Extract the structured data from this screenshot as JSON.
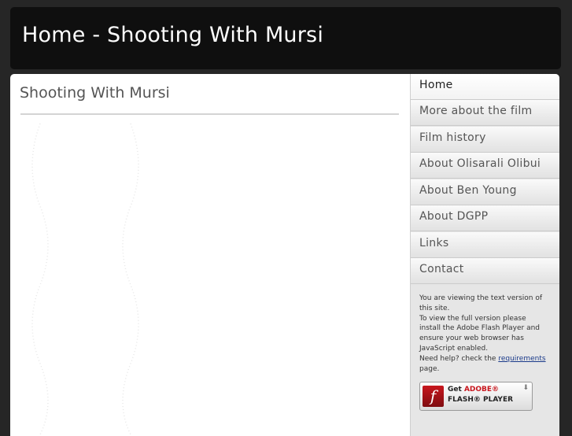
{
  "header": {
    "title": "Home - Shooting With Mursi"
  },
  "main": {
    "heading": "Shooting With Mursi"
  },
  "sidebar": {
    "items": [
      {
        "label": "Home",
        "active": true
      },
      {
        "label": "More about the film"
      },
      {
        "label": "Film history"
      },
      {
        "label": "About Olisarali Olibui"
      },
      {
        "label": "About Ben Young"
      },
      {
        "label": "About DGPP"
      },
      {
        "label": "Links"
      },
      {
        "label": "Contact"
      }
    ],
    "notice": {
      "line1": "You are viewing the text version of this site.",
      "line2": "To view the full version please install the Adobe Flash Player and ensure your web browser has JavaScript enabled.",
      "help_prefix": "Need help? check the",
      "help_link": "requirements",
      "help_suffix": "page."
    },
    "flash_badge": {
      "get": "Get",
      "adobe": "ADOBE®",
      "player": "FLASH® PLAYER",
      "logo_letter": "f"
    }
  },
  "colors": {
    "background": "#262626",
    "header": "#0f0f0f",
    "content": "#ffffff",
    "sidebar": "#e6e6e6"
  }
}
